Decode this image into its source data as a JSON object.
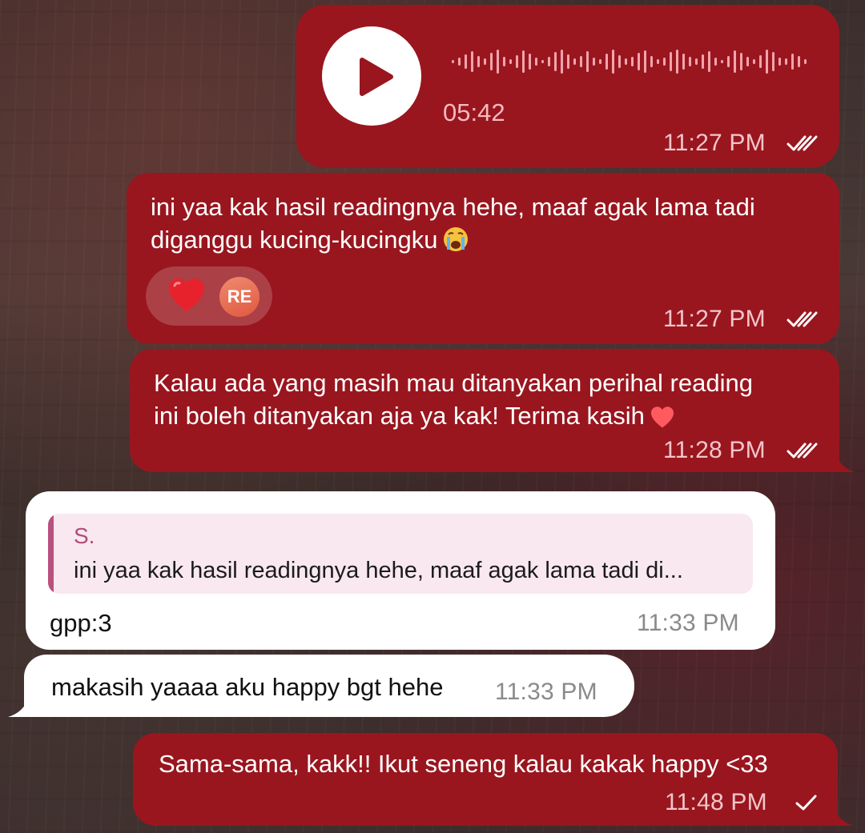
{
  "colors": {
    "outgoing_bubble": "#99161f",
    "incoming_bubble": "#ffffff",
    "reply_accent": "#b9507d",
    "reaction_avatar": "#e0593f"
  },
  "messages": [
    {
      "kind": "voice",
      "direction": "outgoing",
      "icon": "play-icon",
      "duration": "05:42",
      "time": "11:27 PM",
      "status": "read",
      "status_icon": "double-check-icon"
    },
    {
      "kind": "text",
      "direction": "outgoing",
      "line1": "ini yaa kak hasil readingnya hehe, maaf agak lama tadi",
      "line2": "diganggu kucing-kucingku",
      "emoji": "crying-face-emoji",
      "reactions": {
        "emoji": "heart-emoji",
        "avatar_initials": "RE"
      },
      "time": "11:27 PM",
      "status": "read",
      "status_icon": "double-check-icon"
    },
    {
      "kind": "text",
      "direction": "outgoing",
      "line1": "Kalau ada yang masih mau ditanyakan perihal reading",
      "line2": "ini boleh ditanyakan aja ya kak! Terima kasih",
      "emoji": "heart-emoji",
      "time": "11:28 PM",
      "status": "read",
      "status_icon": "double-check-icon"
    },
    {
      "kind": "reply",
      "direction": "incoming",
      "quoted_author": "S.",
      "quoted_text": "ini yaa kak hasil readingnya hehe, maaf agak lama tadi di...",
      "text": "gpp:3",
      "time": "11:33 PM"
    },
    {
      "kind": "text",
      "direction": "incoming",
      "text": "makasih yaaaa aku happy bgt hehe",
      "time": "11:33 PM"
    },
    {
      "kind": "text",
      "direction": "outgoing",
      "text": "Sama-sama, kakk!! Ikut seneng kalau kakak happy <33",
      "time": "11:48 PM",
      "status": "sent",
      "status_icon": "single-check-icon"
    }
  ]
}
